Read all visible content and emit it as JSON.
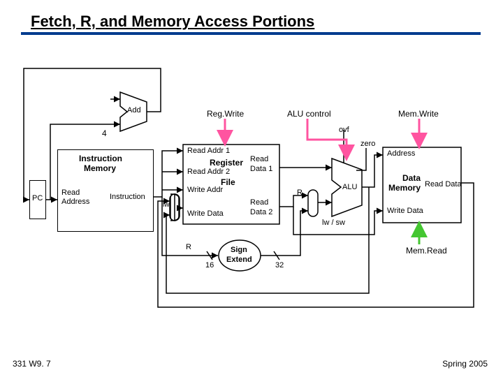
{
  "title": "Fetch, R, and Memory Access Portions",
  "footer_left": "331 W9. 7",
  "footer_right": "Spring 2005",
  "blocks": {
    "add": "Add",
    "four": "4",
    "pc": "PC",
    "imem_line1": "Instruction",
    "imem_line2": "Memory",
    "imem_readaddr_line1": "Read",
    "imem_readaddr_line2": "Address",
    "imem_out": "Instruction",
    "regfile_title1": "Register",
    "regfile_title2": "File",
    "regfile_raddr1": "Read Addr 1",
    "regfile_raddr2": "Read Addr 2",
    "regfile_waddr": "Write Addr",
    "regfile_wdata": "Write Data",
    "regfile_rdata1_a": "Read",
    "regfile_rdata1_b": "Data 1",
    "regfile_rdata2_a": "Read",
    "regfile_rdata2_b": "Data 2",
    "signext": "Sign",
    "signext2": "Extend",
    "signext_in": "16",
    "signext_out": "32",
    "alu": "ALU",
    "alu_ovf": "ovf",
    "alu_zero": "zero",
    "dmem_title1": "Data",
    "dmem_title2": "Memory",
    "dmem_addr": "Address",
    "dmem_rdata": "Read Data",
    "dmem_wdata": "Write Data",
    "mux_lw": "lw",
    "mux_r_top": "R",
    "mux_lwsw": "lw / sw",
    "mux_r_bottom": "R"
  },
  "signals": {
    "regwrite": "Reg.Write",
    "alucontrol": "ALU control",
    "memwrite": "Mem.Write",
    "memread": "Mem.Read"
  }
}
